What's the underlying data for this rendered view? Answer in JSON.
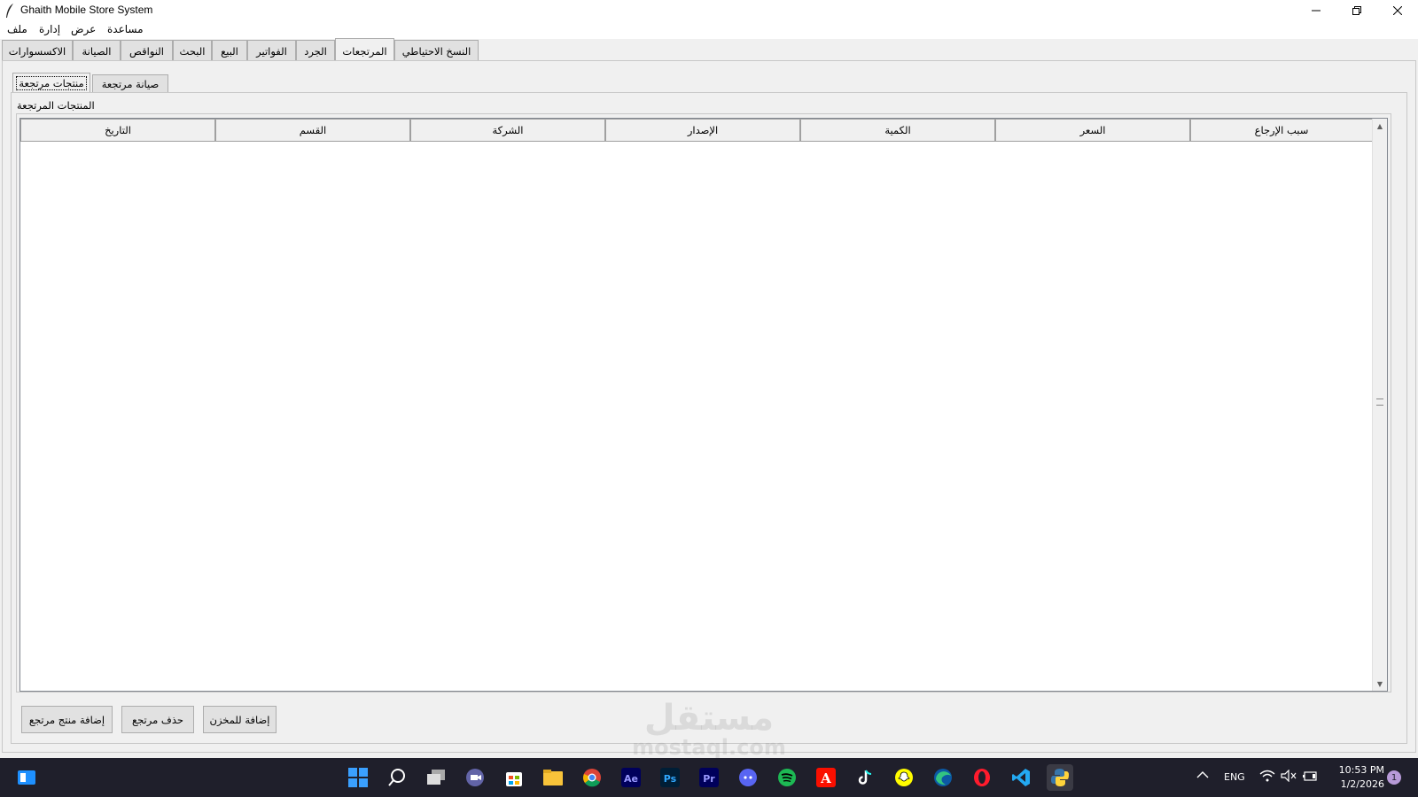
{
  "window": {
    "title": "Ghaith Mobile Store System"
  },
  "menu": [
    "ملف",
    "إدارة",
    "عرض",
    "مساعدة"
  ],
  "main_tabs": [
    "الاكسسوارات",
    "الصيانة",
    "النواقص",
    "البحث",
    "البيع",
    "الفواتير",
    "الجرد",
    "المرتجعات",
    "النسخ الاحتياطي"
  ],
  "active_main_tab": "المرتجعات",
  "sub_tabs": [
    "منتجات مرتجعة",
    "صيانة مرتجعة"
  ],
  "active_sub_tab": "منتجات مرتجعة",
  "group": {
    "label": "المنتجات المرتجعة"
  },
  "table": {
    "columns": [
      "التاريخ",
      "القسم",
      "الشركة",
      "الإصدار",
      "الكمية",
      "السعر",
      "سبب الإرجاع"
    ],
    "rows": []
  },
  "buttons": {
    "add_returned_product": "إضافة منتج مرتجع",
    "delete_return": "حذف مرتجع",
    "add_to_stock": "إضافة للمخزن"
  },
  "watermark": {
    "arabic": "مستقل",
    "latin": "mostaql.com"
  },
  "taskbar": {
    "language": "ENG",
    "time": "10:53 PM",
    "date": "1/2/2026",
    "notification_count": "1"
  }
}
